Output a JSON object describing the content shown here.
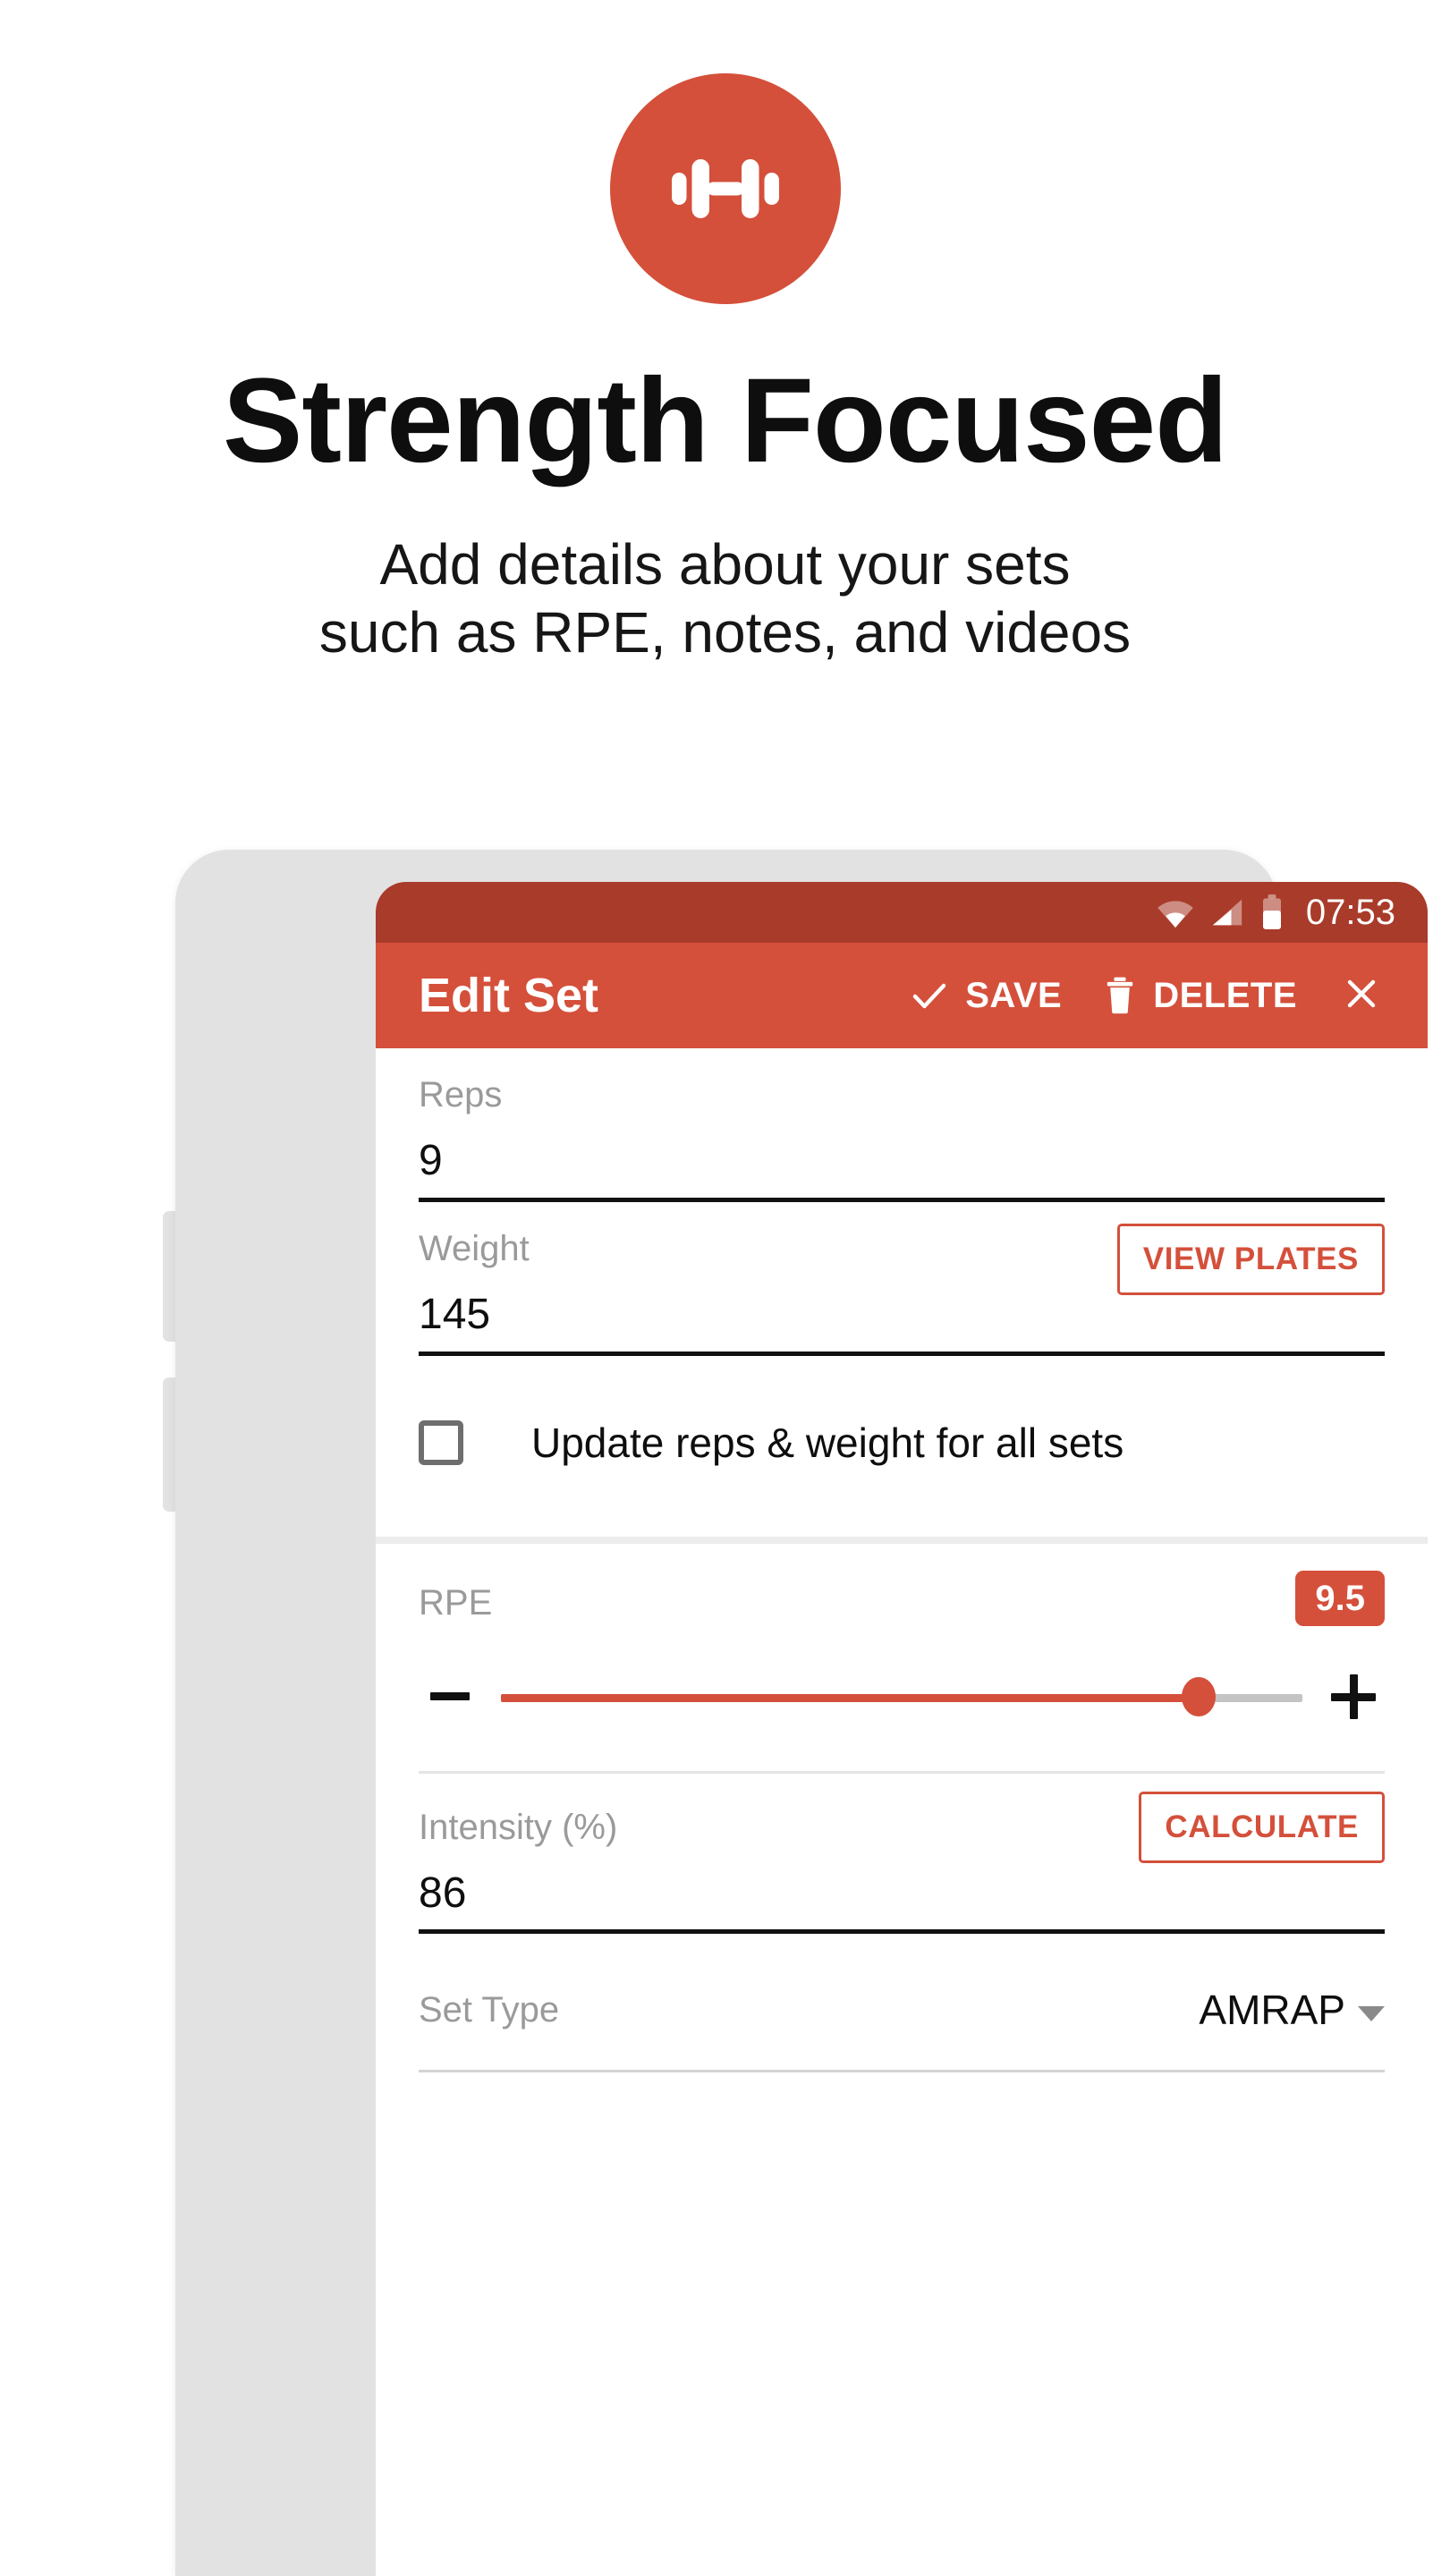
{
  "promo": {
    "logo_icon": "dumbbell-icon",
    "accent_color": "#D4503B",
    "headline": "Strength Focused",
    "subhead_line1": "Add details about your sets",
    "subhead_line2": "such as RPE, notes, and videos"
  },
  "phone": {
    "statusbar": {
      "time": "07:53",
      "icons": [
        "wifi-icon",
        "cell-signal-icon",
        "battery-icon"
      ],
      "background_color": "#A93B2A"
    },
    "appbar": {
      "title": "Edit Set",
      "background_color": "#D4503B",
      "save_label": "SAVE",
      "save_icon": "check-icon",
      "delete_label": "DELETE",
      "delete_icon": "trash-icon",
      "close_icon": "close-icon"
    },
    "form": {
      "reps": {
        "label": "Reps",
        "value": "9"
      },
      "weight": {
        "label": "Weight",
        "value": "145",
        "action_label": "VIEW PLATES"
      },
      "update_all": {
        "label": "Update reps & weight for all sets",
        "checked": false
      },
      "rpe": {
        "label": "RPE",
        "value": "9.5",
        "slider_percent": 87,
        "decrement_icon": "minus-icon",
        "increment_icon": "plus-icon"
      },
      "intensity": {
        "label": "Intensity (%)",
        "value": "86",
        "action_label": "CALCULATE"
      },
      "set_type": {
        "label": "Set Type",
        "value": "AMRAP",
        "caret_icon": "chevron-down-icon"
      }
    }
  }
}
